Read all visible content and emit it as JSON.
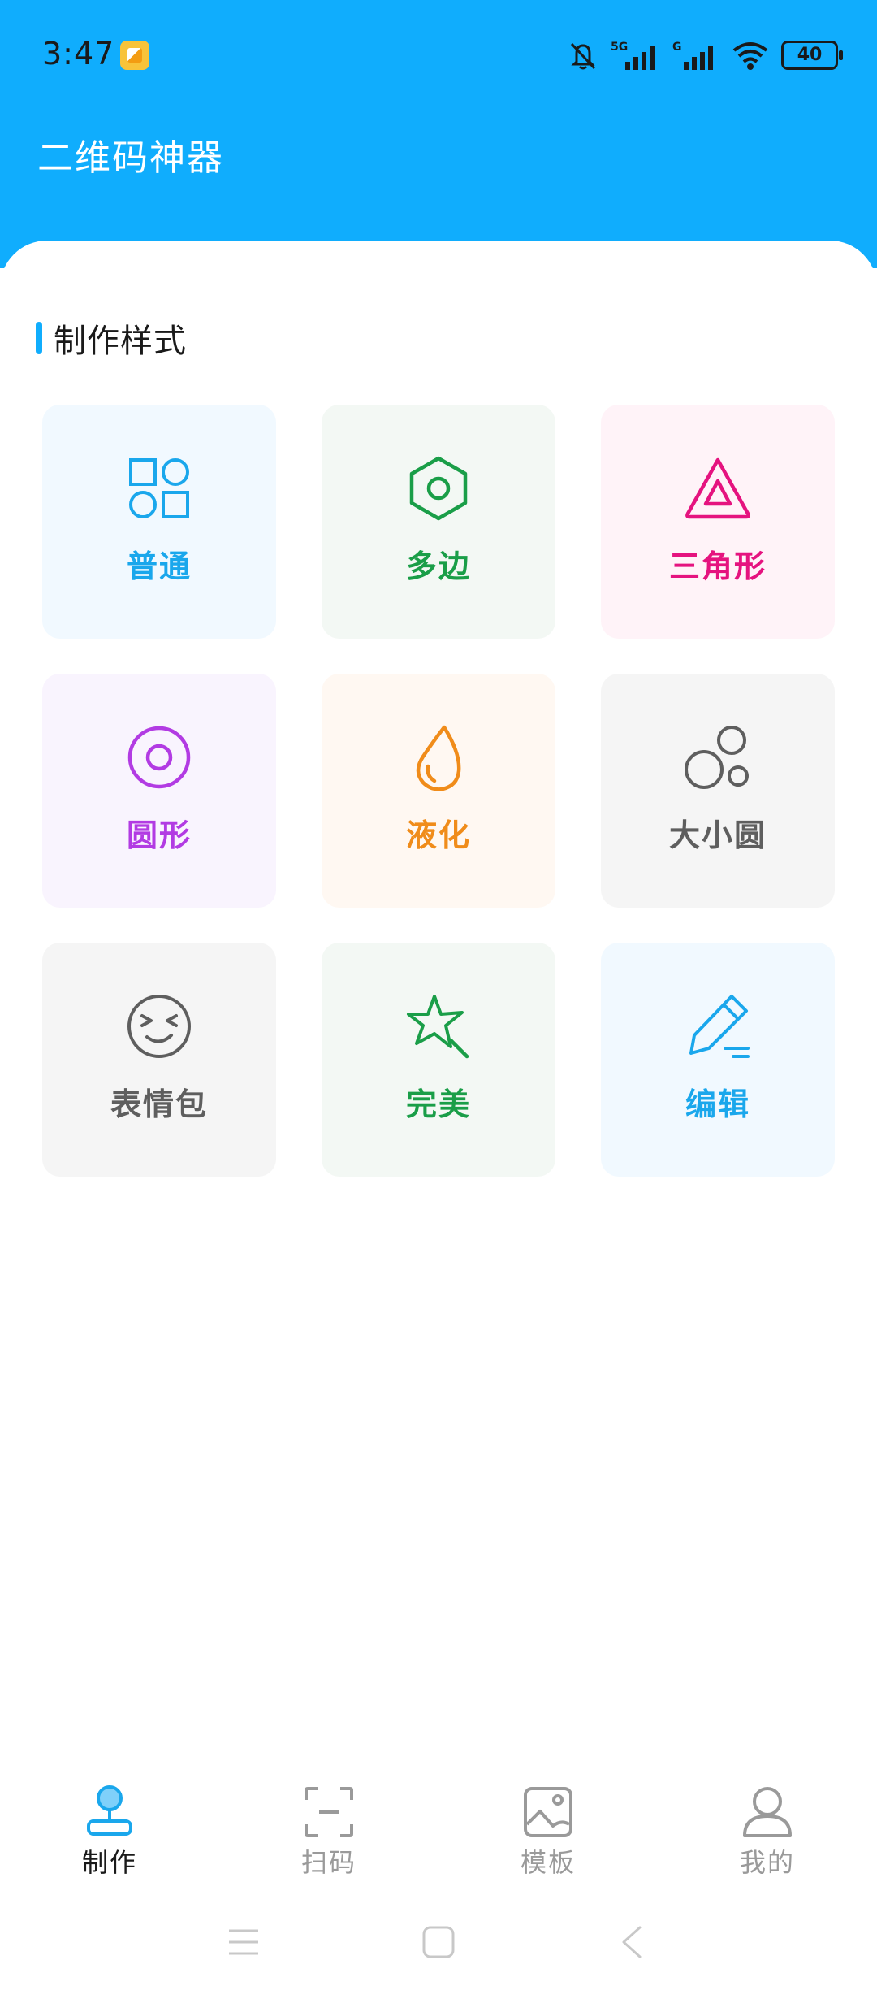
{
  "status_bar": {
    "time": "3:47",
    "battery": "40",
    "icons": [
      "notification-app-icon",
      "mute-bell-icon",
      "signal-5g-icon",
      "signal-g-icon",
      "wifi-icon",
      "battery-icon"
    ]
  },
  "header": {
    "title": "二维码神器"
  },
  "section": {
    "title": "制作样式"
  },
  "styles": [
    {
      "label": "普通",
      "icon": "squares-circles-icon",
      "color": "#1aa7ec",
      "bg": "#f1f9ff"
    },
    {
      "label": "多边",
      "icon": "hexagon-icon",
      "color": "#1a9e48",
      "bg": "#f3f8f4"
    },
    {
      "label": "三角形",
      "icon": "triangle-icon",
      "color": "#e5137f",
      "bg": "#fff3f8"
    },
    {
      "label": "圆形",
      "icon": "ring-icon",
      "color": "#b23be3",
      "bg": "#f9f4fe"
    },
    {
      "label": "液化",
      "icon": "droplet-icon",
      "color": "#f08c1a",
      "bg": "#fff8f2"
    },
    {
      "label": "大小圆",
      "icon": "bubbles-icon",
      "color": "#5e5e5e",
      "bg": "#f5f5f5"
    },
    {
      "label": "表情包",
      "icon": "emoji-face-icon",
      "color": "#5e5e5e",
      "bg": "#f5f5f5"
    },
    {
      "label": "完美",
      "icon": "star-wand-icon",
      "color": "#1a9e48",
      "bg": "#f3f8f4"
    },
    {
      "label": "编辑",
      "icon": "pencil-icon",
      "color": "#1aa7ec",
      "bg": "#f1f9ff"
    }
  ],
  "nav": {
    "items": [
      {
        "label": "制作",
        "icon": "joystick-icon",
        "active": true
      },
      {
        "label": "扫码",
        "icon": "scan-icon",
        "active": false
      },
      {
        "label": "模板",
        "icon": "image-icon",
        "active": false
      },
      {
        "label": "我的",
        "icon": "user-icon",
        "active": false
      }
    ],
    "active_color": "#1a1a1a",
    "inactive_color": "#9a9a9a"
  },
  "system_nav": {
    "icons": [
      "menu-icon",
      "home-icon",
      "back-icon"
    ]
  }
}
